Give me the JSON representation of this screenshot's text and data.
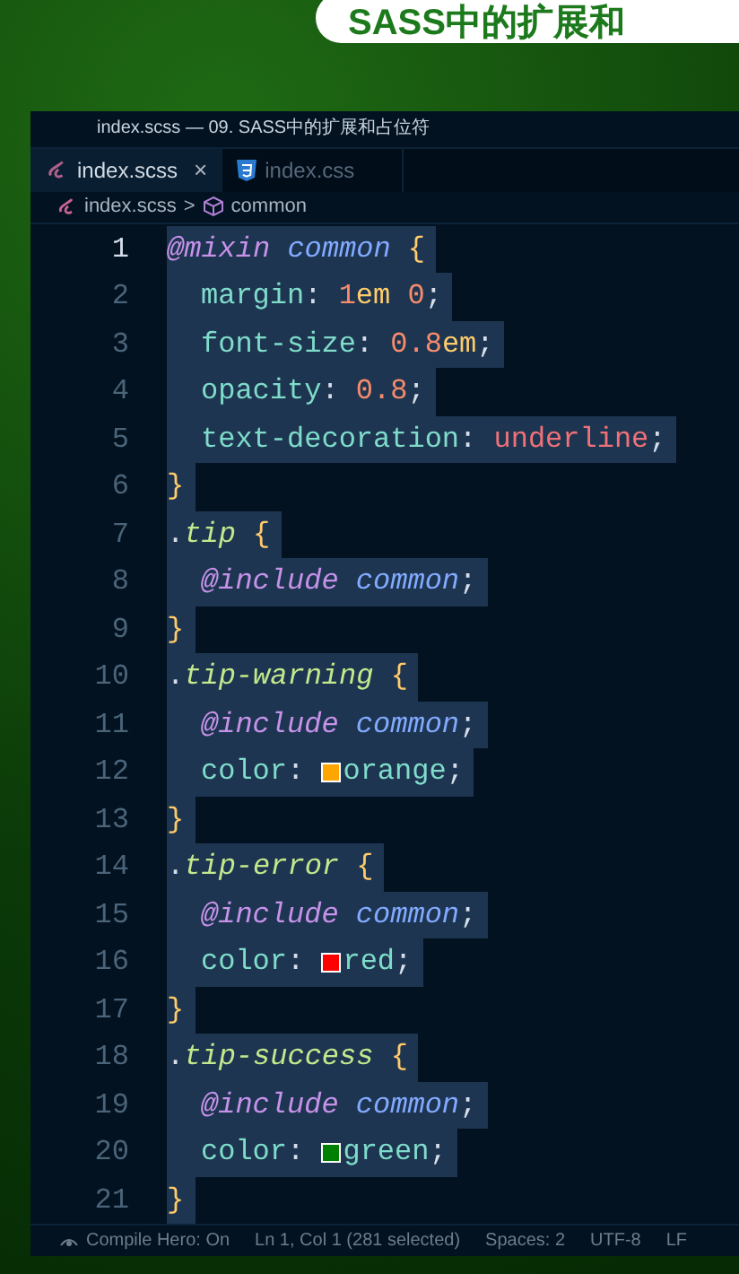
{
  "banner": {
    "title": "SASS中的扩展和"
  },
  "window": {
    "title": "index.scss — 09. SASS中的扩展和占位符"
  },
  "tabs": [
    {
      "label": "index.scss",
      "kind": "sass",
      "selected": true,
      "close": "×"
    },
    {
      "label": "index.css",
      "kind": "css",
      "selected": false
    }
  ],
  "breadcrumb": {
    "file": "index.scss",
    "separator": ">",
    "symbol": "common"
  },
  "editor": {
    "lines": [
      {
        "number": "1",
        "active": true,
        "indented": false,
        "tokens": [
          {
            "t": "@mixin",
            "kind": "keyword"
          },
          {
            "kind": "space"
          },
          {
            "t": "common",
            "kind": "name"
          },
          {
            "kind": "space"
          },
          {
            "t": "{",
            "kind": "brace"
          }
        ]
      },
      {
        "number": "2",
        "active": false,
        "indented": true,
        "tokens": [
          {
            "t": "margin",
            "kind": "property"
          },
          {
            "t": ": ",
            "kind": "punct"
          },
          {
            "t": "1",
            "kind": "number"
          },
          {
            "t": "em",
            "kind": "unit"
          },
          {
            "kind": "space"
          },
          {
            "t": "0",
            "kind": "number"
          },
          {
            "t": ";",
            "kind": "punct"
          }
        ]
      },
      {
        "number": "3",
        "active": false,
        "indented": true,
        "tokens": [
          {
            "t": "font-size",
            "kind": "property"
          },
          {
            "t": ": ",
            "kind": "punct"
          },
          {
            "t": "0.8",
            "kind": "number"
          },
          {
            "t": "em",
            "kind": "unit"
          },
          {
            "t": ";",
            "kind": "punct"
          }
        ]
      },
      {
        "number": "4",
        "active": false,
        "indented": true,
        "tokens": [
          {
            "t": "opacity",
            "kind": "property"
          },
          {
            "t": ": ",
            "kind": "punct"
          },
          {
            "t": "0.8",
            "kind": "number"
          },
          {
            "t": ";",
            "kind": "punct"
          }
        ]
      },
      {
        "number": "5",
        "active": false,
        "indented": true,
        "tokens": [
          {
            "t": "text-decoration",
            "kind": "property"
          },
          {
            "t": ": ",
            "kind": "punct"
          },
          {
            "t": "underline",
            "kind": "constant"
          },
          {
            "t": ";",
            "kind": "punct"
          }
        ]
      },
      {
        "number": "6",
        "active": false,
        "indented": false,
        "tokens": [
          {
            "t": "}",
            "kind": "brace"
          }
        ]
      },
      {
        "number": "7",
        "active": false,
        "indented": false,
        "tokens": [
          {
            "t": ".",
            "kind": "punct"
          },
          {
            "t": "tip",
            "kind": "selector"
          },
          {
            "kind": "space"
          },
          {
            "t": "{",
            "kind": "brace"
          }
        ]
      },
      {
        "number": "8",
        "active": false,
        "indented": true,
        "tokens": [
          {
            "t": "@include",
            "kind": "keyword"
          },
          {
            "kind": "space"
          },
          {
            "t": "common",
            "kind": "name"
          },
          {
            "t": ";",
            "kind": "punct"
          }
        ]
      },
      {
        "number": "9",
        "active": false,
        "indented": false,
        "tokens": [
          {
            "t": "}",
            "kind": "brace"
          }
        ]
      },
      {
        "number": "10",
        "active": false,
        "indented": false,
        "tokens": [
          {
            "t": ".",
            "kind": "punct"
          },
          {
            "t": "tip-warning",
            "kind": "selector"
          },
          {
            "kind": "space"
          },
          {
            "t": "{",
            "kind": "brace"
          }
        ]
      },
      {
        "number": "11",
        "active": false,
        "indented": true,
        "tokens": [
          {
            "t": "@include",
            "kind": "keyword"
          },
          {
            "kind": "space"
          },
          {
            "t": "common",
            "kind": "name"
          },
          {
            "t": ";",
            "kind": "punct"
          }
        ]
      },
      {
        "number": "12",
        "active": false,
        "indented": true,
        "tokens": [
          {
            "t": "color",
            "kind": "property"
          },
          {
            "t": ": ",
            "kind": "punct"
          },
          {
            "kind": "swatch",
            "color": "#ffa500"
          },
          {
            "t": "orange",
            "kind": "property"
          },
          {
            "t": ";",
            "kind": "punct"
          }
        ]
      },
      {
        "number": "13",
        "active": false,
        "indented": false,
        "tokens": [
          {
            "t": "}",
            "kind": "brace"
          }
        ]
      },
      {
        "number": "14",
        "active": false,
        "indented": false,
        "tokens": [
          {
            "t": ".",
            "kind": "punct"
          },
          {
            "t": "tip-error",
            "kind": "selector"
          },
          {
            "kind": "space"
          },
          {
            "t": "{",
            "kind": "brace"
          }
        ]
      },
      {
        "number": "15",
        "active": false,
        "indented": true,
        "tokens": [
          {
            "t": "@include",
            "kind": "keyword"
          },
          {
            "kind": "space"
          },
          {
            "t": "common",
            "kind": "name"
          },
          {
            "t": ";",
            "kind": "punct"
          }
        ]
      },
      {
        "number": "16",
        "active": false,
        "indented": true,
        "tokens": [
          {
            "t": "color",
            "kind": "property"
          },
          {
            "t": ": ",
            "kind": "punct"
          },
          {
            "kind": "swatch",
            "color": "#ff0000"
          },
          {
            "t": "red",
            "kind": "property"
          },
          {
            "t": ";",
            "kind": "punct"
          }
        ]
      },
      {
        "number": "17",
        "active": false,
        "indented": false,
        "tokens": [
          {
            "t": "}",
            "kind": "brace"
          }
        ]
      },
      {
        "number": "18",
        "active": false,
        "indented": false,
        "tokens": [
          {
            "t": ".",
            "kind": "punct"
          },
          {
            "t": "tip-success",
            "kind": "selector"
          },
          {
            "kind": "space"
          },
          {
            "t": "{",
            "kind": "brace"
          }
        ]
      },
      {
        "number": "19",
        "active": false,
        "indented": true,
        "tokens": [
          {
            "t": "@include",
            "kind": "keyword"
          },
          {
            "kind": "space"
          },
          {
            "t": "common",
            "kind": "name"
          },
          {
            "t": ";",
            "kind": "punct"
          }
        ]
      },
      {
        "number": "20",
        "active": false,
        "indented": true,
        "tokens": [
          {
            "t": "color",
            "kind": "property"
          },
          {
            "t": ": ",
            "kind": "punct"
          },
          {
            "kind": "swatch",
            "color": "#008000"
          },
          {
            "t": "green",
            "kind": "property"
          },
          {
            "t": ";",
            "kind": "punct"
          }
        ]
      },
      {
        "number": "21",
        "active": false,
        "indented": false,
        "tokens": [
          {
            "t": "}",
            "kind": "brace"
          }
        ]
      }
    ]
  },
  "status_bar": {
    "items": [
      "Compile Hero: On",
      "Ln 1, Col 1 (281 selected)",
      "Spaces: 2",
      "UTF-8",
      "LF"
    ]
  }
}
